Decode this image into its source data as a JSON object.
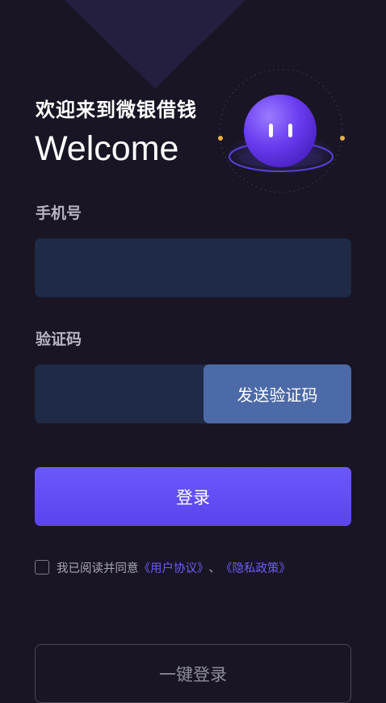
{
  "header": {
    "greeting": "欢迎来到微银借钱",
    "welcome": "Welcome"
  },
  "form": {
    "phone_label": "手机号",
    "phone_value": "",
    "code_label": "验证码",
    "code_value": "",
    "send_code_label": "发送验证码",
    "login_label": "登录"
  },
  "agreement": {
    "checked": false,
    "prefix": "我已阅读并同意",
    "user_agreement": "《用户协议》",
    "separator": "、",
    "privacy_policy": "《隐私政策》"
  },
  "one_key_login_label": "一键登录",
  "colors": {
    "background": "#191524",
    "accent": "#6a58fb",
    "input_bg": "#1e2a46",
    "send_button": "#4c6aa8",
    "link": "#6a5cf5"
  },
  "icons": {
    "mascot": "purple-ball-mascot-icon"
  }
}
